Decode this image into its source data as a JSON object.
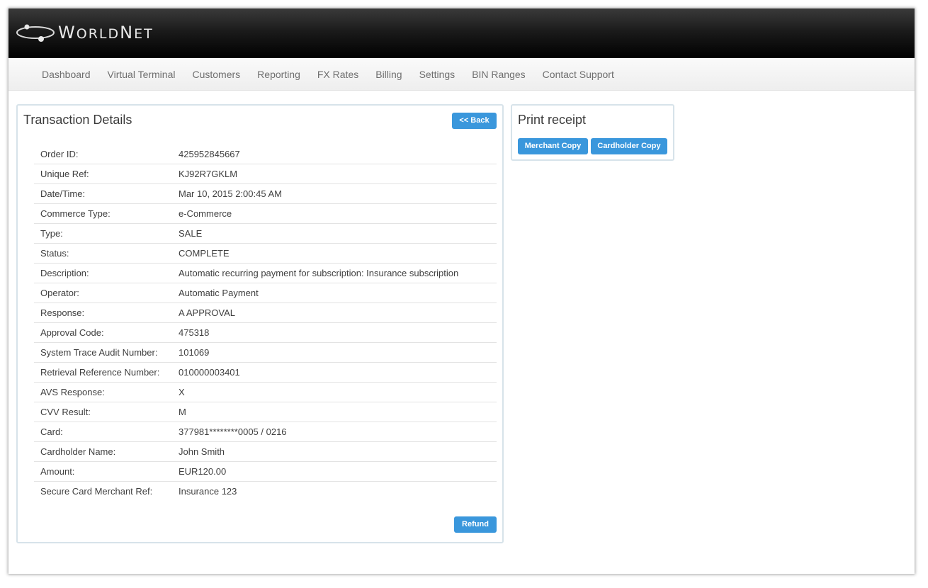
{
  "brand": {
    "logo_icon": "worldnet-orbit-logo",
    "name_first": "W",
    "name_rest_1": "ORLD",
    "name_n": "N",
    "name_rest_2": "ET"
  },
  "nav": {
    "items": [
      {
        "label": "Dashboard"
      },
      {
        "label": "Virtual Terminal"
      },
      {
        "label": "Customers"
      },
      {
        "label": "Reporting"
      },
      {
        "label": "FX Rates"
      },
      {
        "label": "Billing"
      },
      {
        "label": "Settings"
      },
      {
        "label": "BIN Ranges"
      },
      {
        "label": "Contact Support"
      }
    ]
  },
  "details": {
    "title": "Transaction Details",
    "back_label": "<< Back",
    "refund_label": "Refund",
    "rows": [
      {
        "label": "Order ID:",
        "value": "425952845667"
      },
      {
        "label": "Unique Ref:",
        "value": "KJ92R7GKLM"
      },
      {
        "label": "Date/Time:",
        "value": "Mar 10, 2015 2:00:45 AM"
      },
      {
        "label": "Commerce Type:",
        "value": "e-Commerce"
      },
      {
        "label": "Type:",
        "value": "SALE"
      },
      {
        "label": "Status:",
        "value": "COMPLETE"
      },
      {
        "label": "Description:",
        "value": "Automatic recurring payment for subscription: Insurance subscription"
      },
      {
        "label": "Operator:",
        "value": "Automatic Payment"
      },
      {
        "label": "Response:",
        "value": "A APPROVAL"
      },
      {
        "label": "Approval Code:",
        "value": "475318"
      },
      {
        "label": "System Trace Audit Number:",
        "value": "101069"
      },
      {
        "label": "Retrieval Reference Number:",
        "value": "010000003401"
      },
      {
        "label": "AVS Response:",
        "value": "X"
      },
      {
        "label": "CVV Result:",
        "value": "M"
      },
      {
        "label": "Card:",
        "value": "377981********0005 / 0216"
      },
      {
        "label": "Cardholder Name:",
        "value": "John Smith"
      },
      {
        "label": "Amount:",
        "value": "EUR120.00"
      },
      {
        "label": "Secure Card Merchant Ref:",
        "value": "Insurance 123"
      }
    ]
  },
  "print": {
    "title": "Print receipt",
    "merchant_label": "Merchant Copy",
    "cardholder_label": "Cardholder Copy"
  },
  "colors": {
    "header_bg": "#000000",
    "button_blue": "#3a97dc",
    "panel_border": "#d7e3ea",
    "nav_text": "#6f6f6f"
  }
}
